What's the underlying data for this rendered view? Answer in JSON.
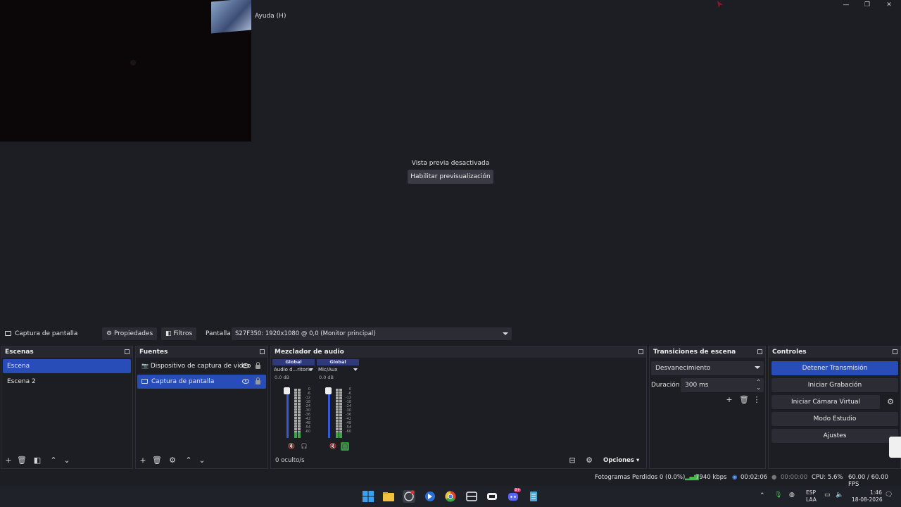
{
  "menu": {
    "help_label": "Ayuda (H)"
  },
  "window": {
    "minimize": "—",
    "maximize": "❐",
    "close": "✕"
  },
  "preview": {
    "disabled_message": "Vista previa desactivada",
    "enable_button": "Habilitar previsualización"
  },
  "source_toolbar": {
    "selected_source": "Captura de pantalla",
    "properties_label": "Propiedades",
    "filters_label": "Filtros",
    "display_label": "Pantalla",
    "display_value": "S27F350: 1920x1080 @ 0,0 (Monitor principal)"
  },
  "scenes": {
    "title": "Escenas",
    "items": [
      {
        "label": "Escena",
        "selected": true
      },
      {
        "label": "Escena 2",
        "selected": false
      }
    ]
  },
  "sources": {
    "title": "Fuentes",
    "items": [
      {
        "label": "Dispositivo de captura de video",
        "icon": "camera-icon",
        "selected": false
      },
      {
        "label": "Captura de pantalla",
        "icon": "monitor-icon",
        "selected": true
      }
    ]
  },
  "mixer": {
    "title": "Mezclador de audio",
    "strips": [
      {
        "global": "Global",
        "name": "Audio d...ritorio",
        "db": "0.0 dB",
        "headphones_active": false
      },
      {
        "global": "Global",
        "name": "Mic/Aux",
        "db": "0.0 dB",
        "headphones_active": true
      }
    ],
    "scale": [
      "0",
      "-6",
      "-12",
      "-18",
      "-24",
      "-30",
      "-36",
      "-42",
      "-48",
      "-54",
      "-60"
    ],
    "hidden_count": "0 oculto/s",
    "options_label": "Opciones"
  },
  "transitions": {
    "title": "Transiciones de escena",
    "selected": "Desvanecimiento",
    "duration_label": "Duración",
    "duration_value": "300 ms"
  },
  "controls": {
    "title": "Controles",
    "stop_stream": "Detener Transmisión",
    "start_recording": "Iniciar Grabación",
    "start_virtual_cam": "Iniciar Cámara Virtual",
    "studio_mode": "Modo Estudio",
    "settings": "Ajustes"
  },
  "status": {
    "dropped_frames": "Fotogramas Perdidos 0 (0.0%)",
    "bitrate": "7940 kbps",
    "stream_time": "00:02:06",
    "record_time": "00:00:00",
    "cpu": "CPU: 5.6%",
    "fps": "60.00 / 60.00 FPS"
  },
  "taskbar": {
    "lang_top": "ESP",
    "lang_bottom": "LAA",
    "time": "1:46",
    "date": "18-08-2026",
    "badge": "9+"
  },
  "colors": {
    "accent": "#284cb8",
    "background": "#1d1e24",
    "panel": "#26272f"
  }
}
